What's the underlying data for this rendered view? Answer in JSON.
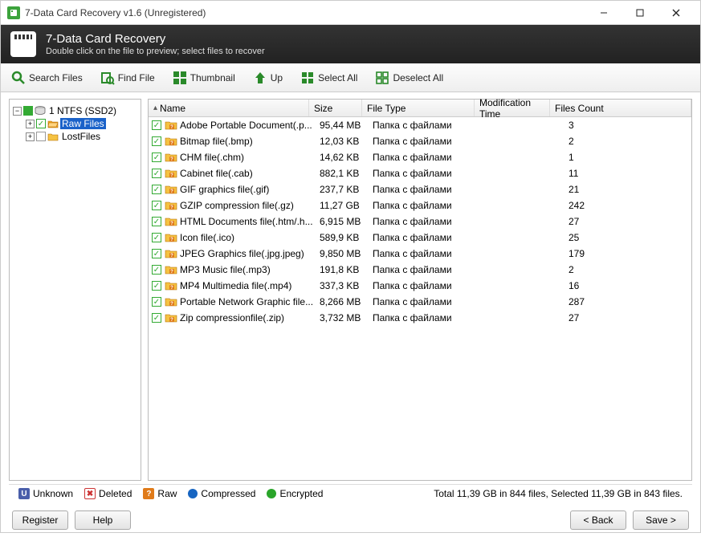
{
  "window": {
    "title": "7-Data Card Recovery v1.6 (Unregistered)"
  },
  "header": {
    "title": "7-Data Card Recovery",
    "subtitle": "Double click on the file to preview; select files to recover"
  },
  "toolbar": {
    "search": "Search Files",
    "find": "Find File",
    "thumbnail": "Thumbnail",
    "up": "Up",
    "selectall": "Select All",
    "deselectall": "Deselect All"
  },
  "tree": {
    "root": "1 NTFS (SSD2)",
    "raw": "Raw Files",
    "lost": "LostFiles"
  },
  "columns": {
    "name": "Name",
    "size": "Size",
    "type": "File Type",
    "mod": "Modification Time",
    "count": "Files Count"
  },
  "rows": [
    {
      "name": "Adobe Portable Document(.p...",
      "size": "95,44 MB",
      "type": "Папка с файлами",
      "count": "3"
    },
    {
      "name": "Bitmap file(.bmp)",
      "size": "12,03 KB",
      "type": "Папка с файлами",
      "count": "2"
    },
    {
      "name": "CHM file(.chm)",
      "size": "14,62 KB",
      "type": "Папка с файлами",
      "count": "1"
    },
    {
      "name": "Cabinet file(.cab)",
      "size": "882,1 KB",
      "type": "Папка с файлами",
      "count": "11"
    },
    {
      "name": "GIF graphics file(.gif)",
      "size": "237,7 KB",
      "type": "Папка с файлами",
      "count": "21"
    },
    {
      "name": "GZIP compression file(.gz)",
      "size": "11,27 GB",
      "type": "Папка с файлами",
      "count": "242"
    },
    {
      "name": "HTML Documents file(.htm/.h...",
      "size": "6,915 MB",
      "type": "Папка с файлами",
      "count": "27"
    },
    {
      "name": "Icon file(.ico)",
      "size": "589,9 KB",
      "type": "Папка с файлами",
      "count": "25"
    },
    {
      "name": "JPEG Graphics file(.jpg.jpeg)",
      "size": "9,850 MB",
      "type": "Папка с файлами",
      "count": "179"
    },
    {
      "name": "MP3 Music file(.mp3)",
      "size": "191,8 KB",
      "type": "Папка с файлами",
      "count": "2"
    },
    {
      "name": "MP4 Multimedia file(.mp4)",
      "size": "337,3 KB",
      "type": "Папка с файлами",
      "count": "16"
    },
    {
      "name": "Portable Network Graphic file...",
      "size": "8,266 MB",
      "type": "Папка с файлами",
      "count": "287"
    },
    {
      "name": "Zip compressionfile(.zip)",
      "size": "3,732 MB",
      "type": "Папка с файлами",
      "count": "27"
    }
  ],
  "legend": {
    "unknown": "Unknown",
    "deleted": "Deleted",
    "raw": "Raw",
    "compressed": "Compressed",
    "encrypted": "Encrypted",
    "status": "Total 11,39 GB in 844 files, Selected 11,39 GB in 843 files."
  },
  "footer": {
    "register": "Register",
    "help": "Help",
    "back": "< Back",
    "save": "Save >"
  }
}
